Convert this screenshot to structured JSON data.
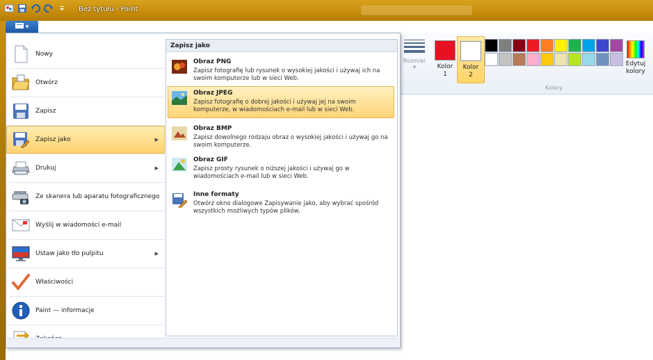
{
  "window": {
    "title": "Bez tytułu - Paint"
  },
  "ribbon": {
    "size_label": "Rozmiar",
    "color1_label": "Kolor 1",
    "color2_label": "Kolor 2",
    "edit_colors_label": "Edytuj kolory",
    "colors_group_label": "Kolory",
    "color1": "#e81123",
    "color2": "#ffffff",
    "palette_row1": [
      "#000000",
      "#7f7f7f",
      "#880015",
      "#ed1c24",
      "#ff7f27",
      "#fff200",
      "#22b14c",
      "#00a2e8",
      "#3f48cc",
      "#a349a4"
    ],
    "palette_row2": [
      "#ffffff",
      "#c3c3c3",
      "#b97a57",
      "#ffaec9",
      "#ffc90e",
      "#efe4b0",
      "#b5e61d",
      "#99d9ea",
      "#7092be",
      "#c8bfe7"
    ]
  },
  "file_menu": {
    "items": [
      {
        "label": "Nowy",
        "icon": "new-document-icon",
        "has_submenu": false
      },
      {
        "label": "Otwórz",
        "icon": "open-folder-icon",
        "has_submenu": false
      },
      {
        "label": "Zapisz",
        "icon": "save-disk-icon",
        "has_submenu": false
      },
      {
        "label": "Zapisz jako",
        "icon": "save-as-icon",
        "has_submenu": true,
        "active": true
      },
      {
        "label": "Drukuj",
        "icon": "printer-icon",
        "has_submenu": true
      },
      {
        "label": "Ze skanera lub aparatu fotograficznego",
        "icon": "scanner-icon",
        "has_submenu": false
      },
      {
        "label": "Wyślij w wiadomości e-mail",
        "icon": "email-icon",
        "has_submenu": false
      },
      {
        "label": "Ustaw jako tło pulpitu",
        "icon": "desktop-background-icon",
        "has_submenu": true
      },
      {
        "label": "Właściwości",
        "icon": "checkmark-icon",
        "has_submenu": false
      },
      {
        "label": "Paint — informacje",
        "icon": "info-icon",
        "has_submenu": false
      },
      {
        "label": "Zakończ",
        "icon": "exit-icon",
        "has_submenu": false
      }
    ],
    "submenu": {
      "heading": "Zapisz jako",
      "items": [
        {
          "title": "Obraz PNG",
          "desc": "Zapisz fotografię lub rysunek o wysokiej jakości i używaj ich na swoim komputerze lub w sieci Web.",
          "icon": "png-image-icon"
        },
        {
          "title": "Obraz JPEG",
          "desc": "Zapisz fotografię o dobrej jakości i używaj jej na swoim komputerze, w wiadomościach e-mail lub w sieci Web.",
          "icon": "jpeg-image-icon",
          "active": true
        },
        {
          "title": "Obraz BMP",
          "desc": "Zapisz dowolnego rodzaju obraz o wysokiej jakości i używaj go na swoim komputerze.",
          "icon": "bmp-image-icon"
        },
        {
          "title": "Obraz GIF",
          "desc": "Zapisz prosty rysunek o niższej jakości i używaj go w wiadomościach e-mail lub w sieci Web.",
          "icon": "gif-image-icon"
        },
        {
          "title": "Inne formaty",
          "desc": "Otwórz okno dialogowe Zapisywanie jako, aby wybrać spośród wszystkich możliwych typów plików.",
          "icon": "other-formats-icon"
        }
      ]
    }
  }
}
